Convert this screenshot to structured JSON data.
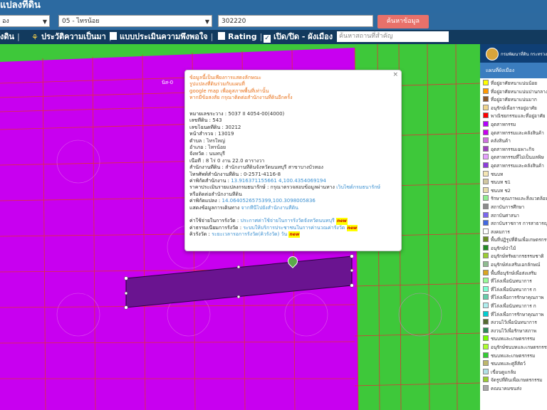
{
  "header": {
    "title": "แปลงที่ดิน"
  },
  "search": {
    "district_value": "อง",
    "subdistrict_value": "05 - ไทรน้อย",
    "parcel_number_value": "302220",
    "search_button": "ค้นหาข้อมูล"
  },
  "toolbar": {
    "item1": "ังดิน",
    "item2": "ประวัติความเป็นมา",
    "item3": "แบบประเมินความพึงพอใจ",
    "item4": "Rating",
    "item5": "เปิด/ปิด - ผังเมือง",
    "search_placeholder": "ค้นหาสถานที่สำคัญ"
  },
  "map": {
    "parcel_label": "นิส-0"
  },
  "popup": {
    "close": "×",
    "warning_lines": [
      "ข้อมูลนี้เป็นเพียงการแสดงลักษณะ",
      "รูปแปลงที่ดินร่วมกับแผนที่",
      "google map เพื่อดูสภาพพื้นที่เท่านั้น",
      "หากมีข้อสงสัย กรุณาติดต่อสำนักงานที่ดินอีกครั้ง"
    ],
    "rows": [
      {
        "label": "หมายเลขระวาง :",
        "value": "5037 II 4054-00(4000)"
      },
      {
        "label": "เลขที่ดิน :",
        "value": "543"
      },
      {
        "label": "เลขโฉนดที่ดิน :",
        "value": "30212"
      },
      {
        "label": "หน้าสำรวจ :",
        "value": "13019"
      },
      {
        "label": "ตำบล :",
        "value": "ไทรใหญ่"
      },
      {
        "label": "อำเภอ :",
        "value": "ไทรน้อย"
      },
      {
        "label": "จังหวัด :",
        "value": "นนทบุรี"
      },
      {
        "label": "เนื้อที่ :",
        "value": "8 ไร่ 0 งาน 22.0 ตารางวา"
      },
      {
        "label": "สำนักงานที่ดิน :",
        "value": "สำนักงานที่ดินจังหวัดนนทบุรี สาขาบางบัวทอง"
      },
      {
        "label": "โทรศัพท์สำนักงานที่ดิน :",
        "value": "0-2571-4116-8"
      },
      {
        "label": "ค่าพิกัดสำนักงาน :",
        "value": "13.916371155661 4,100.4354069194"
      }
    ],
    "appraisal_label": "ราคาประเมินรายแปลงกรมธนารักษ์ :",
    "appraisal_text": "กรุณาตรวจสอบข้อมูลผ่านทาง",
    "appraisal_link": "เว็บไซต์กรมธนารักษ์",
    "appraisal_text2": "หรือติดต่อสำนักงานที่ดิน",
    "coord_label": "ค่าพิกัดแปลง :",
    "coord_value": "14.0640526575399,100.3098005836",
    "route_label": "แสดงข้อมูลการเดินทาง",
    "route_link": "จากที่นี่ไปยังสำนักงานที่ดิน",
    "fee_label": "ค่าใช้จ่ายในการรังวัด :",
    "fee_link": "ประกาศค่าใช้จ่ายในการรังวัดจังหวัดนนทบุรี",
    "wait_label": "ค่าธรรมเนียมการรังวัด :",
    "wait_link": "ระบบให้บริการประชาชนในการค่านวณค่ารังวัด",
    "queue_label": "คิวรังวัด :",
    "queue_link": "ระยะเวลารอการรังวัด(คิวรังวัด) วัน",
    "new_badge": "new"
  },
  "panel": {
    "org": "กรมพัฒนาที่ดิน กระทรวงมหาดไทย",
    "legend_title": "แผนที่ผังเมือง",
    "legend": [
      {
        "label": "ที่อยู่อาศัยหนาแน่นน้อย",
        "color": "#ffff00"
      },
      {
        "label": "ที่อยู่อาศัยหนาแน่นปานกลาง",
        "color": "#ff9900"
      },
      {
        "label": "ที่อยู่อาศัยหนาแน่นมาก",
        "color": "#8b5a2b"
      },
      {
        "label": "อนุรักษ์เพื่อการอยู่อาศัย",
        "color": "#f0d58c"
      },
      {
        "label": "พาณิชยกรรมและที่อยู่อาศัย",
        "color": "#ff0000"
      },
      {
        "label": "อุตสาหกรรม",
        "color": "#b400ff"
      },
      {
        "label": "อุตสาหกรรมและคลังสินค้า",
        "color": "#c800f0"
      },
      {
        "label": "คลังสินค้า",
        "color": "#d070e0"
      },
      {
        "label": "อุตสาหกรรมเฉพาะกิจ",
        "color": "#a040c0"
      },
      {
        "label": "อุตสาหกรรมที่ไม่เป็นมลพิษ",
        "color": "#e6a0ff"
      },
      {
        "label": "อุตสาหกรรมและคลังสินค้า",
        "color": "#8c3cdc"
      },
      {
        "label": "ชนบท",
        "color": "#f5e6b4"
      },
      {
        "label": "ชนบท ช1",
        "color": "#d2c8a0"
      },
      {
        "label": "ชนบท ช2",
        "color": "#e6dcaa"
      },
      {
        "label": "รักษาคุณภาพและสิ่งแวดล้อม",
        "color": "#90ee90"
      },
      {
        "label": "สถาบันการศึกษา",
        "color": "#8c8c8c"
      },
      {
        "label": "สถาบันศาสนา",
        "color": "#7b68ee"
      },
      {
        "label": "สถาบันราชการ การสาธารณูปโภค",
        "color": "#4169e1"
      },
      {
        "label": "สงคมการ",
        "color": "#ffffff"
      },
      {
        "label": "พื้นที่ปฏิรูปที่ดินเพื่อเกษตรกรรม",
        "color": "#6b8e23"
      },
      {
        "label": "อนุรักษ์ป่าไม้",
        "color": "#228b22"
      },
      {
        "label": "อนุรักษ์ทรัพยากรธรรมชาติ",
        "color": "#9acd32"
      },
      {
        "label": "อนุรักษ์ส่งเสริมเอกลักษณ์",
        "color": "#8fbc8f"
      },
      {
        "label": "พื้นที่อนุรักษ์เพื่อส่งเสริม",
        "color": "#daa520"
      },
      {
        "label": "ที่โล่งเพื่อนันทนาการ",
        "color": "#98fb98"
      },
      {
        "label": "ที่โล่งเพื่อนันทนาการ ก",
        "color": "#7fffd4"
      },
      {
        "label": "ที่โล่งเพื่อการรักษาคุณภาพ",
        "color": "#66cdaa"
      },
      {
        "label": "ที่โล่งเพื่อนันทนาการ ก",
        "color": "#afeeee"
      },
      {
        "label": "ที่โล่งเพื่อการรักษาคุณภาพ",
        "color": "#00ced1"
      },
      {
        "label": "สงวนไว้เพื่อนันทนาการ",
        "color": "#556b2f"
      },
      {
        "label": "สงวนไว้เพื่อรักษาสภาพ",
        "color": "#2e8b57"
      },
      {
        "label": "ชนบทและเกษตรกรรม",
        "color": "#7cfc00"
      },
      {
        "label": "อนุรักษ์ชนบทและเกษตรกรรม",
        "color": "#adff2f"
      },
      {
        "label": "ชนบทและเกษตรกรรม",
        "color": "#32cd32"
      },
      {
        "label": "ชนบทและศูลีสัตว์",
        "color": "#bdb76b"
      },
      {
        "label": "เขื่อนดูแกล้ม",
        "color": "#b0e0e6"
      },
      {
        "label": "จัดรูปที่ดินเพื่อเกษตรกรรม",
        "color": "#9acd32"
      },
      {
        "label": "คณนาคมขนส่ง",
        "color": "#a9a9a9"
      }
    ]
  }
}
